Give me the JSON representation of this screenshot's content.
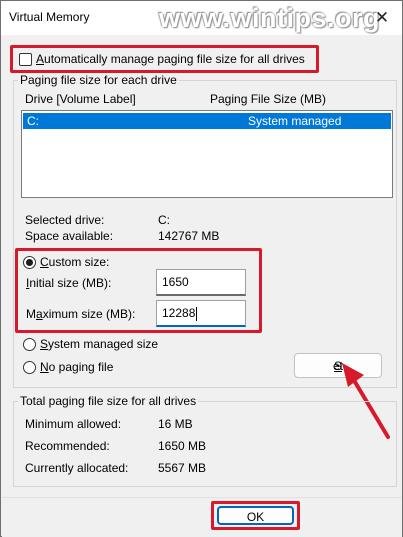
{
  "window": {
    "title": "Virtual Memory",
    "watermark": "www.wintips.org",
    "close_glyph": "✕"
  },
  "auto_manage": {
    "label": "Automatically manage paging file size for all drives",
    "checked": false
  },
  "paging_group": {
    "title": "Paging file size for each drive",
    "col_drive": "Drive  [Volume Label]",
    "col_size": "Paging File Size (MB)",
    "rows": [
      {
        "drive": "C:",
        "size": "System managed",
        "selected": true
      }
    ]
  },
  "selected_drive": {
    "label": "Selected drive:",
    "value": "C:"
  },
  "space_available": {
    "label": "Space available:",
    "value": "142767 MB"
  },
  "custom_size": {
    "label": "Custom size:",
    "selected": true
  },
  "initial_size": {
    "label": "Initial size (MB):",
    "value": "1650"
  },
  "maximum_size": {
    "label": "Maximum size (MB):",
    "value": "12288"
  },
  "system_managed": {
    "label": "System managed size",
    "selected": false
  },
  "no_paging": {
    "label": "No paging file",
    "selected": false
  },
  "set_button": {
    "label": "Set"
  },
  "total_group": {
    "title": "Total paging file size for all drives",
    "minimum": {
      "label": "Minimum allowed:",
      "value": "16 MB"
    },
    "recommended": {
      "label": "Recommended:",
      "value": "1650 MB"
    },
    "allocated": {
      "label": "Currently allocated:",
      "value": "5567 MB"
    }
  },
  "ok_button": {
    "label": "OK"
  },
  "colors": {
    "highlight": "#d6192b",
    "selection": "#0078d7",
    "accent": "#0067c0"
  }
}
